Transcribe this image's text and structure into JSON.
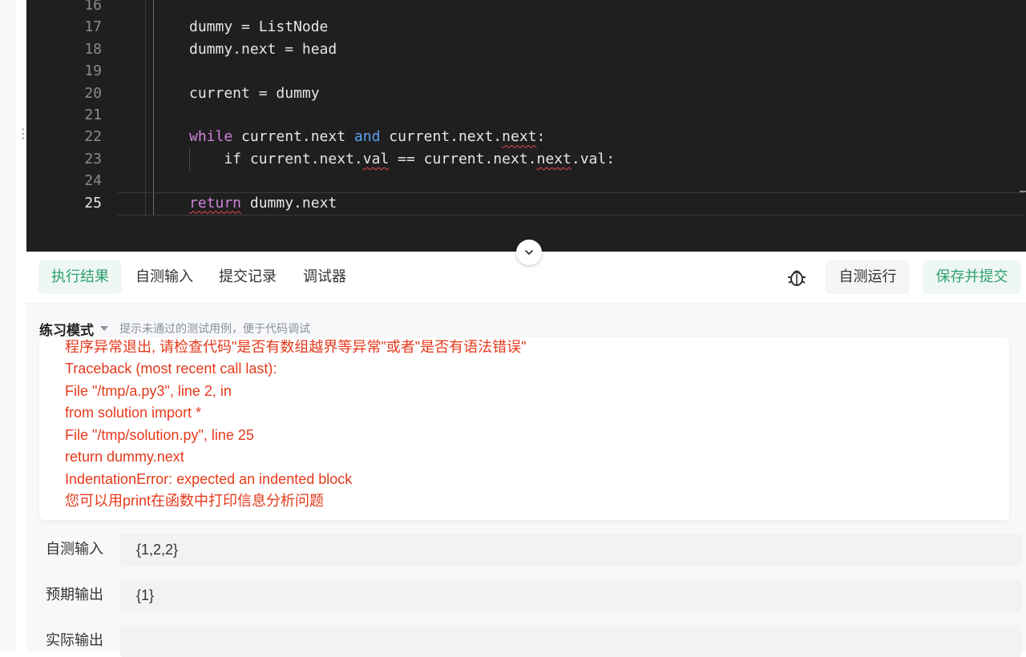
{
  "editor": {
    "lines": [
      {
        "num": "16",
        "segments": []
      },
      {
        "num": "17",
        "segments": [
          {
            "text": "dummy = ListNode",
            "style": "plain"
          }
        ]
      },
      {
        "num": "18",
        "segments": [
          {
            "text": "dummy.next = head",
            "style": "plain"
          }
        ]
      },
      {
        "num": "19",
        "segments": []
      },
      {
        "num": "20",
        "segments": [
          {
            "text": "current = dummy",
            "style": "plain"
          }
        ]
      },
      {
        "num": "21",
        "segments": []
      },
      {
        "num": "22",
        "segments": [
          {
            "text": "while",
            "style": "kw-purple"
          },
          {
            "text": " current.next ",
            "style": "plain"
          },
          {
            "text": "and",
            "style": "kw-blue"
          },
          {
            "text": " current.next.",
            "style": "plain"
          },
          {
            "text": "next",
            "style": "squiggle"
          },
          {
            "text": ":",
            "style": "plain"
          }
        ]
      },
      {
        "num": "23",
        "segments": [
          {
            "text": "    if current.next.",
            "style": "plain"
          },
          {
            "text": "val",
            "style": "squiggle"
          },
          {
            "text": " == current.next.",
            "style": "plain"
          },
          {
            "text": "next",
            "style": "squiggle"
          },
          {
            "text": ".val:",
            "style": "plain"
          }
        ]
      },
      {
        "num": "24",
        "segments": []
      },
      {
        "num": "25",
        "segments": [
          {
            "text": "return",
            "style": "kw-purple squiggle"
          },
          {
            "text": " dummy.next",
            "style": "plain"
          }
        ],
        "active": true
      }
    ]
  },
  "icons": {
    "collapse": "chevron-down-icon",
    "debug": "bug-icon",
    "mode_dropdown": "caret-down-icon",
    "drag": "vertical-dots-icon"
  },
  "tabs": [
    {
      "label": "执行结果",
      "active": true
    },
    {
      "label": "自测输入",
      "active": false
    },
    {
      "label": "提交记录",
      "active": false
    },
    {
      "label": "调试器",
      "active": false
    }
  ],
  "actions": {
    "run_label": "自测运行",
    "submit_label": "保存并提交"
  },
  "mode": {
    "title": "练习模式",
    "hint": "提示未通过的测试用例，便于代码调试"
  },
  "error": {
    "lines": [
      "程序异常退出, 请检查代码\"是否有数组越界等异常\"或者\"是否有语法错误\"",
      "Traceback (most recent call last):",
      "File \"/tmp/a.py3\", line 2, in",
      "from solution import *",
      "File \"/tmp/solution.py\", line 25",
      "return dummy.next",
      "IndentationError: expected an indented block",
      "您可以用print在函数中打印信息分析问题"
    ]
  },
  "io": {
    "input_label": "自测输入",
    "input_value": "{1,2,2}",
    "expected_label": "预期输出",
    "expected_value": "{1}",
    "actual_label": "实际输出",
    "actual_value": ""
  },
  "colors": {
    "accent": "#2da06e",
    "error": "#e5391b",
    "editor_bg": "#1f1f1f",
    "keyword_purple": "#cf83d9",
    "keyword_blue": "#5aa2f0"
  }
}
